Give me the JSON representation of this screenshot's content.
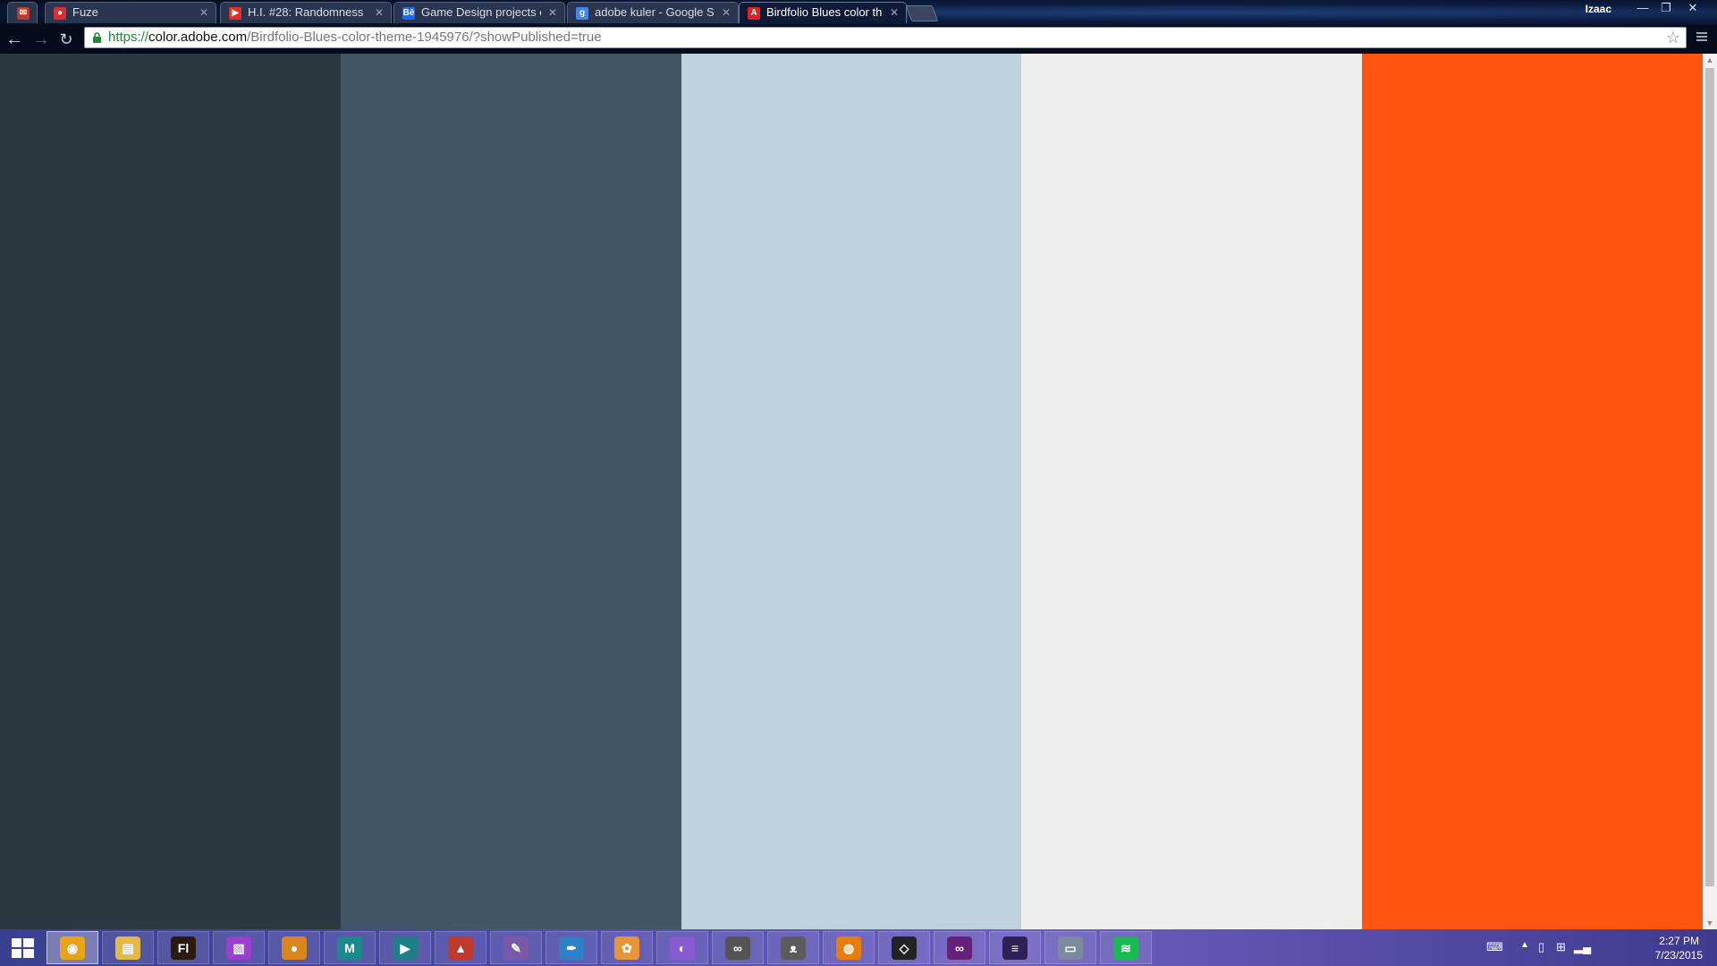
{
  "browser": {
    "tabs": [
      {
        "title": "",
        "icon": "gmail-icon",
        "color": "#c0392b"
      },
      {
        "title": "Fuze",
        "icon": "fuze-icon",
        "color": "#d63031"
      },
      {
        "title": "H.I. #28: Randomness",
        "icon": "youtube-icon",
        "color": "#e52d27"
      },
      {
        "title": "Game Design projects on",
        "icon": "behance-icon",
        "color": "#1769ff"
      },
      {
        "title": "adobe kuler - Google Sea",
        "icon": "google-icon",
        "color": "#4285f4"
      },
      {
        "title": "Birdfolio Blues color them",
        "icon": "adobe-icon",
        "color": "#e01f26"
      }
    ],
    "user_name": "Izaac",
    "url_scheme": "https://",
    "url_host": "color.adobe.com",
    "url_path": "/Birdfolio-Blues-color-theme-1945976/?showPublished=true"
  },
  "palette": {
    "name": "Birdfolio Blues",
    "colors": [
      "#2c3840",
      "#405664",
      "#bed3dd",
      "#eeeeee",
      "#ff5510"
    ]
  },
  "taskbar": {
    "apps": [
      {
        "name": "chrome",
        "glyph": "◉",
        "color": "#e8a317",
        "active": true
      },
      {
        "name": "file-explorer",
        "glyph": "▤",
        "color": "#e6b84a"
      },
      {
        "name": "flash",
        "glyph": "Fl",
        "color": "#2b1a10"
      },
      {
        "name": "color-app",
        "glyph": "▧",
        "color": "#9b3ed1"
      },
      {
        "name": "hexchat",
        "glyph": "●",
        "color": "#d9861f"
      },
      {
        "name": "maya",
        "glyph": "M",
        "color": "#1a8a8c"
      },
      {
        "name": "3ds-max",
        "glyph": "▶",
        "color": "#1f7f86"
      },
      {
        "name": "mudbox",
        "glyph": "▲",
        "color": "#c0392b"
      },
      {
        "name": "onenote",
        "glyph": "✎",
        "color": "#7a5aa8"
      },
      {
        "name": "feather-app",
        "glyph": "✒",
        "color": "#2f80c7"
      },
      {
        "name": "paint-app",
        "glyph": "✿",
        "color": "#e8953a"
      },
      {
        "name": "krita",
        "glyph": "◐",
        "color": "#8a5ad0"
      },
      {
        "name": "cloud-app",
        "glyph": "∞",
        "color": "#555555"
      },
      {
        "name": "gimp",
        "glyph": "ᴥ",
        "color": "#5b5b5b"
      },
      {
        "name": "blender",
        "glyph": "◍",
        "color": "#e87d0d"
      },
      {
        "name": "unity",
        "glyph": "◇",
        "color": "#222222"
      },
      {
        "name": "visual-studio",
        "glyph": "∞",
        "color": "#68217a"
      },
      {
        "name": "eclipse",
        "glyph": "≡",
        "color": "#2c2255"
      },
      {
        "name": "screen-app",
        "glyph": "▭",
        "color": "#7b8a9c"
      },
      {
        "name": "spotify",
        "glyph": "≋",
        "color": "#1db954"
      }
    ],
    "time": "2:27 PM",
    "date": "7/23/2015"
  }
}
